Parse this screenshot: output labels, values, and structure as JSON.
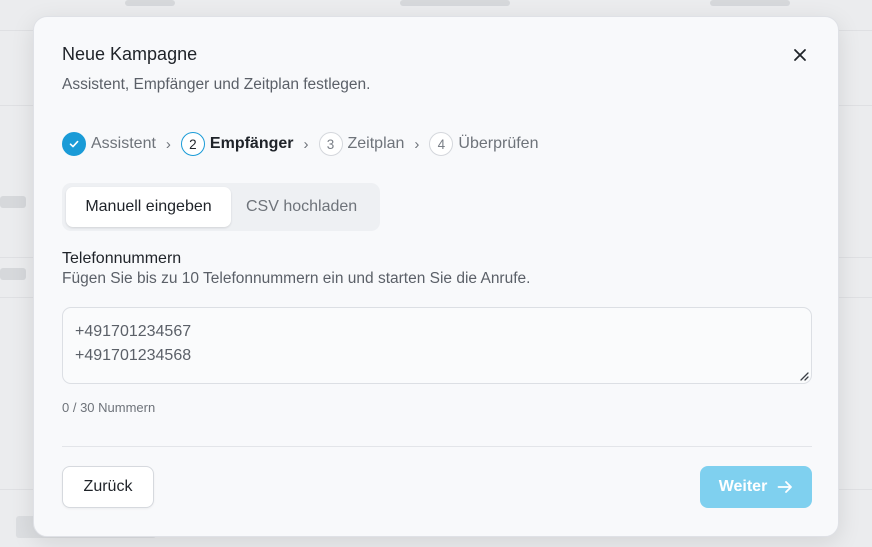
{
  "modal": {
    "title": "Neue Kampagne",
    "subtitle": "Assistent, Empfänger und Zeitplan festlegen.",
    "close_icon": "close-icon"
  },
  "stepper": {
    "steps": [
      {
        "number": "1",
        "label": "Assistent",
        "state": "done"
      },
      {
        "number": "2",
        "label": "Empfänger",
        "state": "active"
      },
      {
        "number": "3",
        "label": "Zeitplan",
        "state": "upcoming"
      },
      {
        "number": "4",
        "label": "Überprüfen",
        "state": "upcoming"
      }
    ],
    "separator": "›"
  },
  "input_mode": {
    "options": [
      "Manuell eingeben",
      "CSV hochladen"
    ],
    "selected": "Manuell eingeben"
  },
  "phone_field": {
    "label": "Telefonnummern",
    "help": "Fügen Sie bis zu 10 Telefonnummern ein und starten Sie die Anrufe.",
    "lines": [
      "+491701234567",
      "+491701234568"
    ],
    "counter": "0 / 30 Nummern"
  },
  "footer": {
    "back_label": "Zurück",
    "next_label": "Weiter"
  },
  "colors": {
    "accent": "#1a9bd7",
    "next_button_disabled": "#7fd0ef"
  }
}
